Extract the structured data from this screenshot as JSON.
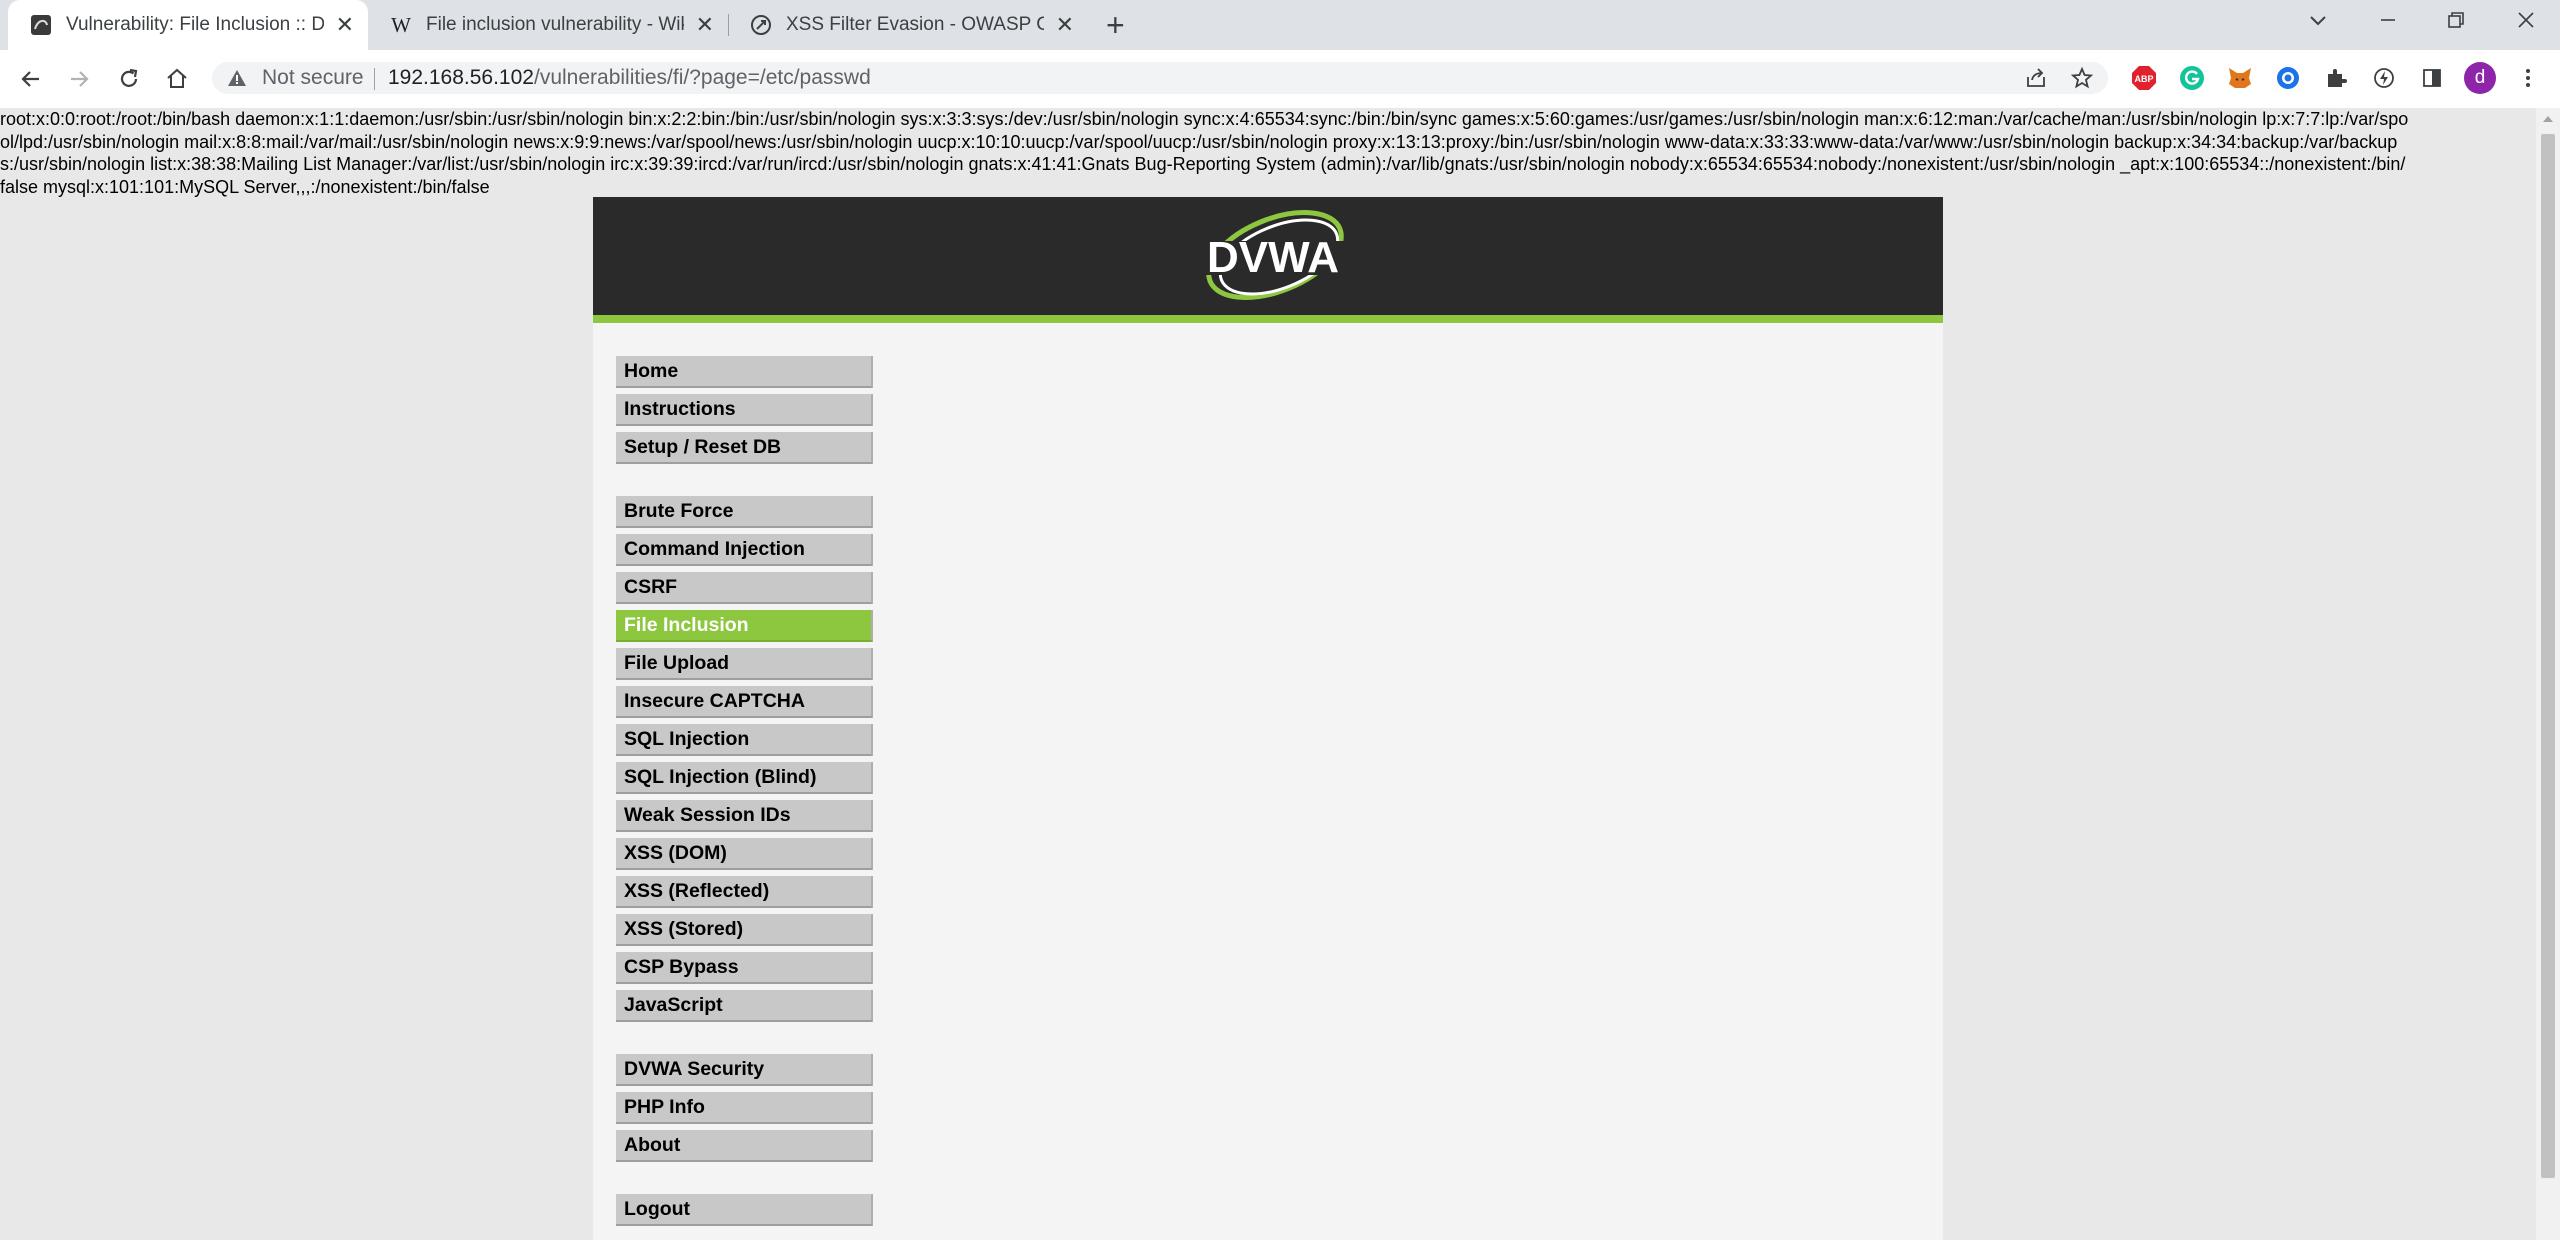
{
  "browser": {
    "tabs": [
      {
        "title": "Vulnerability: File Inclusion :: Damn Vulnerable Web Application (DVWA)",
        "icon": "dvwa-favicon",
        "active": true
      },
      {
        "title": "File inclusion vulnerability - Wikipedia",
        "icon": "wikipedia-icon",
        "active": false
      },
      {
        "title": "XSS Filter Evasion - OWASP Cheat Sheet Series",
        "icon": "owasp-icon",
        "active": false
      }
    ],
    "new_tab_symbol": "+",
    "security_label": "Not secure",
    "url_host": "192.168.56.102",
    "url_path": "/vulnerabilities/fi/?page=/etc/passwd",
    "profile_initial": "d",
    "extensions": [
      "adblock-plus-icon",
      "grammarly-icon",
      "metamask-icon",
      "circle-extension-icon",
      "puzzle-extensions-icon",
      "performance-icon"
    ]
  },
  "page": {
    "passwd_dump": "root:x:0:0:root:/root:/bin/bash daemon:x:1:1:daemon:/usr/sbin:/usr/sbin/nologin bin:x:2:2:bin:/bin:/usr/sbin/nologin sys:x:3:3:sys:/dev:/usr/sbin/nologin sync:x:4:65534:sync:/bin:/bin/sync games:x:5:60:games:/usr/games:/usr/sbin/nologin man:x:6:12:man:/var/cache/man:/usr/sbin/nologin lp:x:7:7:lp:/var/spool/lpd:/usr/sbin/nologin mail:x:8:8:mail:/var/mail:/usr/sbin/nologin news:x:9:9:news:/var/spool/news:/usr/sbin/nologin uucp:x:10:10:uucp:/var/spool/uucp:/usr/sbin/nologin proxy:x:13:13:proxy:/bin:/usr/sbin/nologin www-data:x:33:33:www-data:/var/www:/usr/sbin/nologin backup:x:34:34:backup:/var/backups:/usr/sbin/nologin list:x:38:38:Mailing List Manager:/var/list:/usr/sbin/nologin irc:x:39:39:ircd:/var/run/ircd:/usr/sbin/nologin gnats:x:41:41:Gnats Bug-Reporting System (admin):/var/lib/gnats:/usr/sbin/nologin nobody:x:65534:65534:nobody:/nonexistent:/usr/sbin/nologin _apt:x:100:65534::/nonexistent:/bin/false mysql:x:101:101:MySQL Server,,,:/nonexistent:/bin/false",
    "logo_text": "DVWA",
    "menu_groups": [
      [
        "Home",
        "Instructions",
        "Setup / Reset DB"
      ],
      [
        "Brute Force",
        "Command Injection",
        "CSRF",
        "File Inclusion",
        "File Upload",
        "Insecure CAPTCHA",
        "SQL Injection",
        "SQL Injection (Blind)",
        "Weak Session IDs",
        "XSS (DOM)",
        "XSS (Reflected)",
        "XSS (Stored)",
        "CSP Bypass",
        "JavaScript"
      ],
      [
        "DVWA Security",
        "PHP Info",
        "About"
      ],
      [
        "Logout"
      ]
    ],
    "selected_menu_item": "File Inclusion",
    "colors": {
      "header_bg": "#2a2a2a",
      "accent_green": "#8dc63f",
      "menu_item_bg": "#c8c8c8",
      "content_bg": "#f4f4f4"
    }
  }
}
